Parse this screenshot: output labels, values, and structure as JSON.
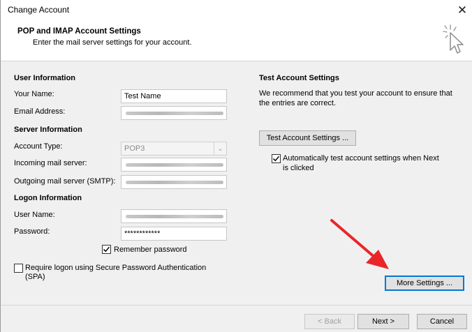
{
  "window": {
    "title": "Change Account"
  },
  "header": {
    "title": "POP and IMAP Account Settings",
    "subtitle": "Enter the mail server settings for your account."
  },
  "user_info": {
    "section": "User Information",
    "name_label": "Your Name:",
    "name_value": "Test Name",
    "email_label": "Email Address:"
  },
  "server_info": {
    "section": "Server Information",
    "account_type_label": "Account Type:",
    "account_type_value": "POP3",
    "incoming_label": "Incoming mail server:",
    "outgoing_label": "Outgoing mail server (SMTP):"
  },
  "logon_info": {
    "section": "Logon Information",
    "username_label": "User Name:",
    "password_label": "Password:",
    "password_value": "************",
    "remember_label": "Remember password",
    "remember_checked": true,
    "spa_label_line1": "Require logon using Secure Password Authentication",
    "spa_label_line2": "(SPA)",
    "spa_checked": false
  },
  "test_settings": {
    "section": "Test Account Settings",
    "desc_line1": "We recommend that you test your account to ensure that",
    "desc_line2": "the entries are correct.",
    "test_button": "Test Account Settings ...",
    "auto_label_line1": "Automatically test account settings when Next",
    "auto_label_line2": "is clicked",
    "auto_checked": true
  },
  "buttons": {
    "more_settings": "More Settings ...",
    "back": "< Back",
    "next": "Next >",
    "cancel": "Cancel"
  },
  "colors": {
    "arrow": "#e8262a",
    "focus": "#0078d7"
  }
}
